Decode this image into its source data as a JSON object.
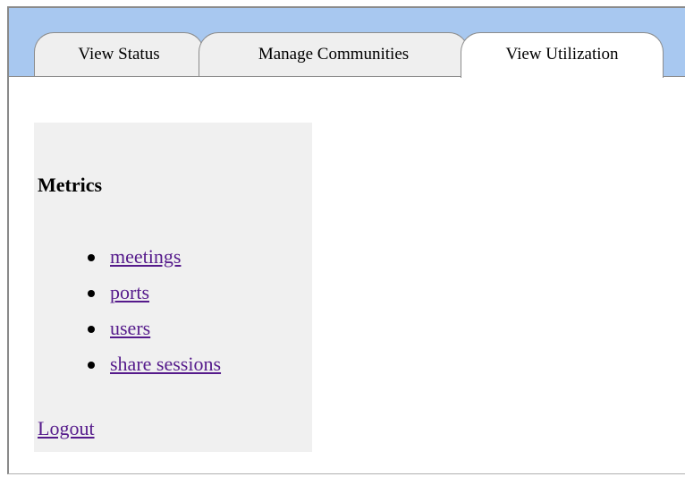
{
  "tabs": [
    {
      "label": "View Status",
      "active": false
    },
    {
      "label": "Manage Communities",
      "active": false
    },
    {
      "label": "View Utilization",
      "active": true
    }
  ],
  "sidebar": {
    "heading": "Metrics",
    "items": [
      {
        "label": "meetings"
      },
      {
        "label": "ports"
      },
      {
        "label": "users"
      },
      {
        "label": "share sessions"
      }
    ],
    "logout_label": "Logout"
  },
  "colors": {
    "tabbar_bg": "#a8c8f0",
    "sidebar_bg": "#f0f0f0",
    "link": "#551a8b"
  }
}
